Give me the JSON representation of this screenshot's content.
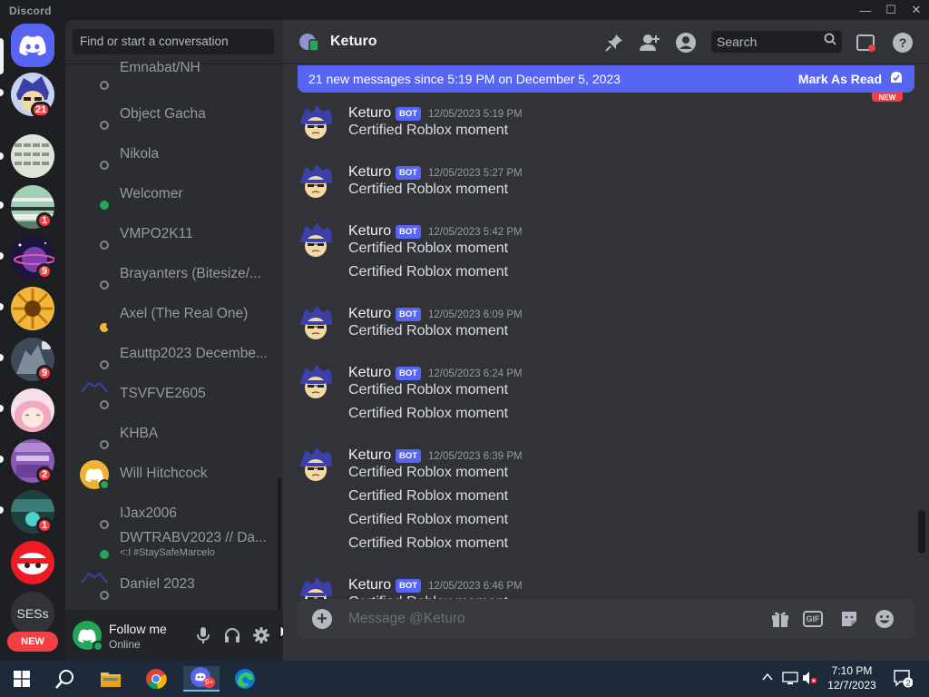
{
  "window": {
    "title": "Discord",
    "controls": [
      "—",
      "☐",
      "✕"
    ]
  },
  "servers": [
    {
      "name": "discord-home",
      "badge": "",
      "color": "#5865f2"
    },
    {
      "name": "server-keturo",
      "badge": "21",
      "color": "#7b8cc8"
    },
    {
      "name": "server-grid",
      "badge": "",
      "color": "#cfd6cc"
    },
    {
      "name": "server-stripes",
      "badge": "1",
      "color": "#8fb7a4"
    },
    {
      "name": "server-planet",
      "badge": "9",
      "color": "#3a2a6b"
    },
    {
      "name": "server-sunflower",
      "badge": "",
      "color": "#e2a52a"
    },
    {
      "name": "server-dark",
      "badge": "9",
      "color": "#3c4a5a"
    },
    {
      "name": "server-anime",
      "badge": "",
      "color": "#f2d3de"
    },
    {
      "name": "server-green",
      "badge": "2",
      "color": "#8b5ab8"
    },
    {
      "name": "server-teal",
      "badge": "1",
      "color": "#2f6b6a"
    },
    {
      "name": "server-red",
      "badge": "",
      "color": "#ed1c24"
    },
    {
      "name": "server-sess",
      "label": "SESs",
      "badge": "",
      "color": "#313338"
    }
  ],
  "new_pill": "NEW",
  "dm_search": {
    "placeholder": "Find or start a conversation"
  },
  "dms": [
    {
      "name": "Emnabat/NH",
      "status": "offline",
      "sub": ""
    },
    {
      "name": "Object Gacha",
      "status": "offline",
      "sub": ""
    },
    {
      "name": "Nikola",
      "status": "offline",
      "sub": ""
    },
    {
      "name": "Welcomer",
      "status": "online",
      "sub": ""
    },
    {
      "name": "VMPO2K11",
      "status": "offline",
      "sub": ""
    },
    {
      "name": "Brayanters (Bitesize/...",
      "status": "offline",
      "sub": ""
    },
    {
      "name": "Axel (The Real One)",
      "status": "idle",
      "sub": ""
    },
    {
      "name": "Eauttp2023 Decembe...",
      "status": "offline",
      "sub": ""
    },
    {
      "name": "TSVFVE2605",
      "status": "offline",
      "sub": ""
    },
    {
      "name": "KHBA",
      "status": "offline",
      "sub": ""
    },
    {
      "name": "Will Hitchcock",
      "status": "online",
      "sub": ""
    },
    {
      "name": "IJax2006",
      "status": "offline",
      "sub": ""
    },
    {
      "name": "DWTRABV2023 // Da...",
      "status": "online",
      "sub": "<:l #StaySafeMarcelo"
    },
    {
      "name": "Daniel 2023",
      "status": "offline",
      "sub": ""
    }
  ],
  "user_panel": {
    "name": "Follow me",
    "status": "Online"
  },
  "chat": {
    "title": "Keturo",
    "search_placeholder": "Search",
    "new_messages_text": "21 new messages since 5:19 PM on December 5, 2023",
    "mark_as_read": "Mark As Read",
    "new_tag": "NEW",
    "composer_placeholder": "Message @Keturo",
    "gif_label": "GIF",
    "groups": [
      {
        "author": "Keturo",
        "badge": "BOT",
        "time": "12/05/2023 5:19 PM",
        "lines": [
          "Certified Roblox moment"
        ]
      },
      {
        "author": "Keturo",
        "badge": "BOT",
        "time": "12/05/2023 5:27 PM",
        "lines": [
          "Certified Roblox moment"
        ]
      },
      {
        "author": "Keturo",
        "badge": "BOT",
        "time": "12/05/2023 5:42 PM",
        "lines": [
          "Certified Roblox moment",
          "Certified Roblox moment"
        ]
      },
      {
        "author": "Keturo",
        "badge": "BOT",
        "time": "12/05/2023 6:09 PM",
        "lines": [
          "Certified Roblox moment"
        ]
      },
      {
        "author": "Keturo",
        "badge": "BOT",
        "time": "12/05/2023 6:24 PM",
        "lines": [
          "Certified Roblox moment",
          "Certified Roblox moment"
        ]
      },
      {
        "author": "Keturo",
        "badge": "BOT",
        "time": "12/05/2023 6:39 PM",
        "lines": [
          "Certified Roblox moment",
          "Certified Roblox moment",
          "Certified Roblox moment",
          "Certified Roblox moment"
        ]
      },
      {
        "author": "Keturo",
        "badge": "BOT",
        "time": "12/05/2023 6:46 PM",
        "lines": [
          "Certified Roblox moment"
        ]
      }
    ]
  },
  "taskbar": {
    "time": "7:10 PM",
    "date": "12/7/2023",
    "notifications": "2",
    "discord_badge": "9+"
  },
  "colors": {
    "blurple": "#5865f2",
    "online": "#23a55a",
    "danger": "#f23f43",
    "idle": "#f0b232"
  }
}
